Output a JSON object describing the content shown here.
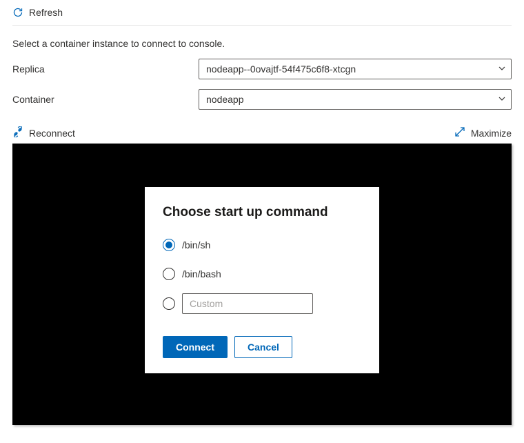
{
  "toolbar": {
    "refresh_label": "Refresh"
  },
  "instruction": "Select a container instance to connect to console.",
  "form": {
    "replica_label": "Replica",
    "replica_value": "nodeapp--0ovajtf-54f475c6f8-xtcgn",
    "container_label": "Container",
    "container_value": "nodeapp"
  },
  "console_toolbar": {
    "reconnect_label": "Reconnect",
    "maximize_label": "Maximize"
  },
  "dialog": {
    "title": "Choose start up command",
    "options": {
      "binsh": "/bin/sh",
      "binbash": "/bin/bash",
      "custom_placeholder": "Custom"
    },
    "connect_label": "Connect",
    "cancel_label": "Cancel"
  }
}
